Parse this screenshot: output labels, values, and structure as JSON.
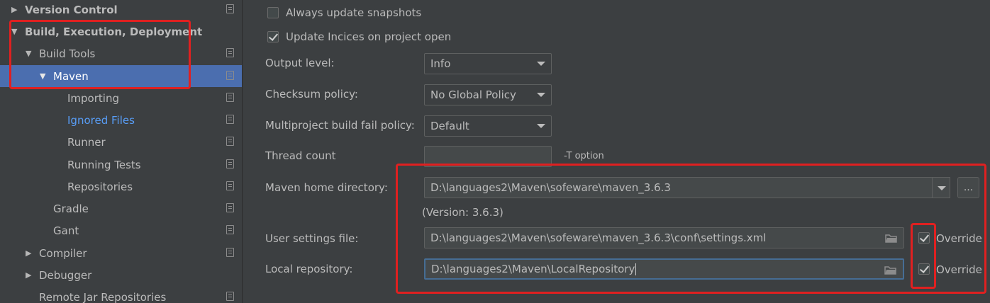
{
  "sidebar": {
    "items": [
      {
        "label": "Version Control",
        "arrow": "▶",
        "bold": true
      },
      {
        "label": "Build, Execution, Deployment",
        "arrow": "▼",
        "bold": true
      },
      {
        "label": "Build Tools",
        "arrow": "▼"
      },
      {
        "label": "Maven",
        "arrow": "▼"
      },
      {
        "label": "Importing"
      },
      {
        "label": "Ignored Files"
      },
      {
        "label": "Runner"
      },
      {
        "label": "Running Tests"
      },
      {
        "label": "Repositories"
      },
      {
        "label": "Gradle"
      },
      {
        "label": "Gant"
      },
      {
        "label": "Compiler",
        "arrow": "▶"
      },
      {
        "label": "Debugger",
        "arrow": "▶"
      },
      {
        "label": "Remote Jar Repositories"
      }
    ]
  },
  "settings": {
    "always_update_snapshots": {
      "label": "Always update snapshots",
      "checked": false
    },
    "update_indices": {
      "label": "Update Incices on project open",
      "checked": true
    },
    "output_level": {
      "label": "Output level:",
      "value": "Info"
    },
    "checksum_policy": {
      "label": "Checksum policy:",
      "value": "No Global Policy"
    },
    "multiproject_fail_policy": {
      "label": "Multiproject build fail policy:",
      "value": "Default"
    },
    "thread_count": {
      "label": "Thread count",
      "value": "",
      "hint": "-T option"
    },
    "maven_home": {
      "label": "Maven home directory:",
      "value": "D:\\languages2\\Maven\\sofeware\\maven_3.6.3",
      "browse_label": "...",
      "version": "(Version: 3.6.3)"
    },
    "user_settings": {
      "label": "User settings file:",
      "value": "D:\\languages2\\Maven\\sofeware\\maven_3.6.3\\conf\\settings.xml",
      "override_label": "Override",
      "override_checked": true
    },
    "local_repository": {
      "label": "Local repository:",
      "value": "D:\\languages2\\Maven\\LocalRepository",
      "override_label": "Override",
      "override_checked": true
    }
  },
  "colors": {
    "background": "#3c3f41",
    "selection": "#4b6eaf",
    "link": "#589df6",
    "highlight_box": "#e02020"
  }
}
